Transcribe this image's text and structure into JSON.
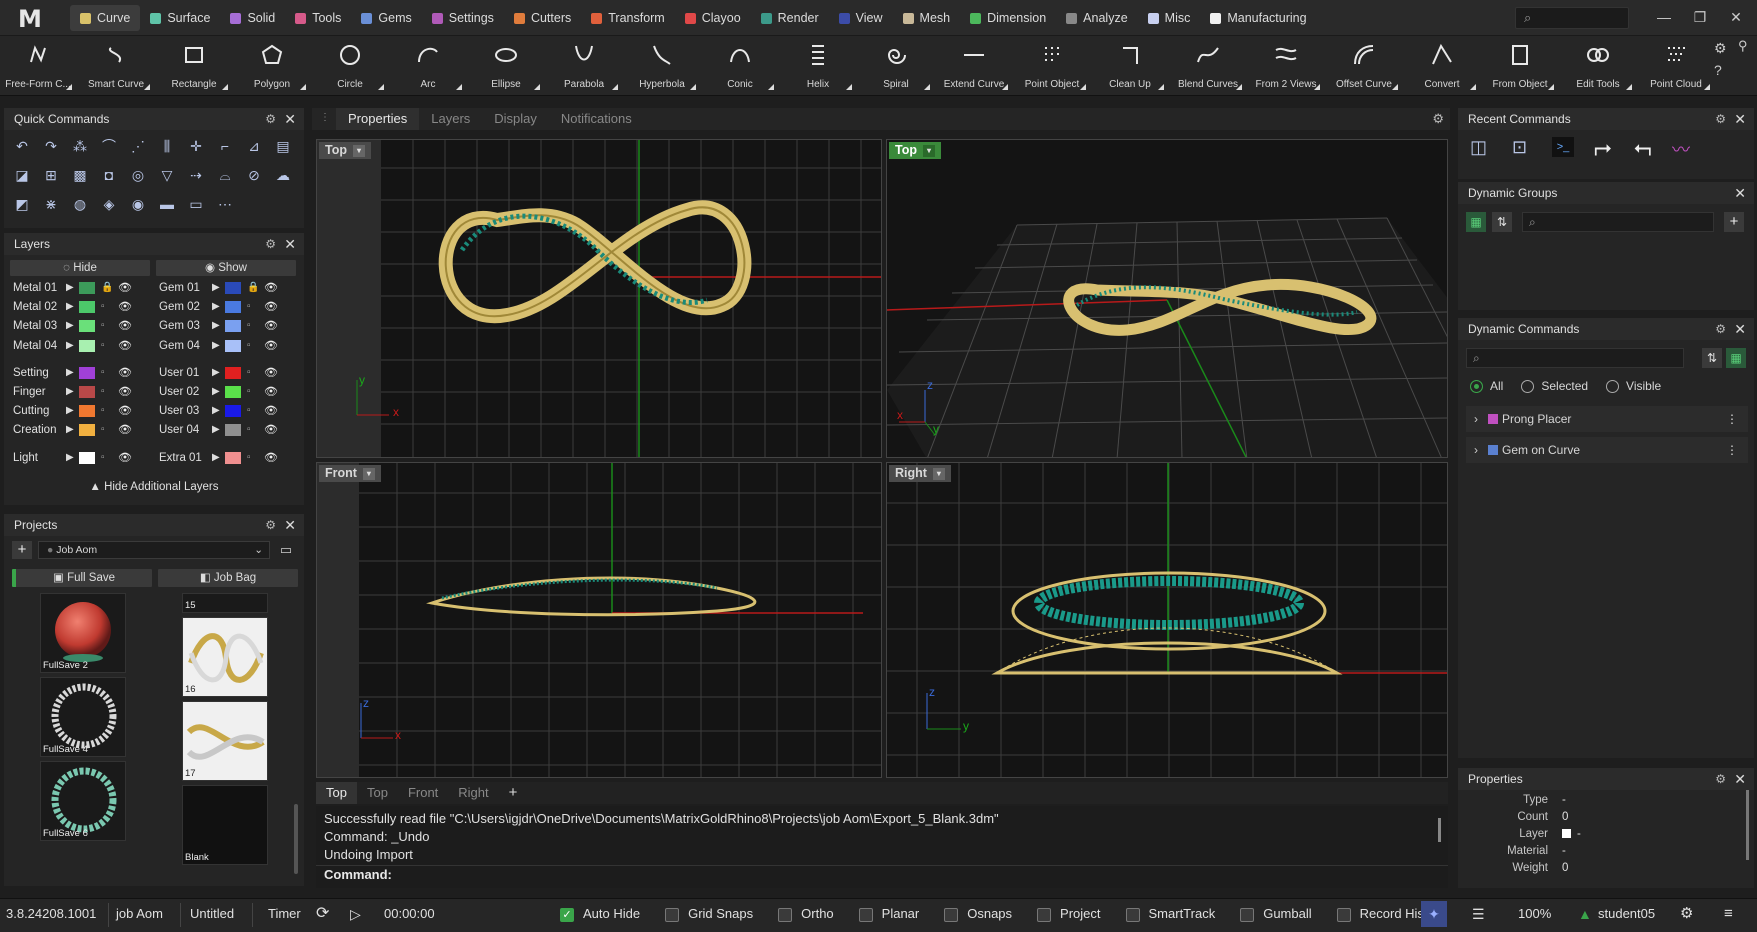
{
  "app": {
    "logo": "M"
  },
  "tabs": [
    {
      "label": "Curve",
      "color": "#d9c26a"
    },
    {
      "label": "Surface",
      "color": "#5fc4a8"
    },
    {
      "label": "Solid",
      "color": "#a66ed6"
    },
    {
      "label": "Tools",
      "color": "#d65a8a"
    },
    {
      "label": "Gems",
      "color": "#6a8fd6"
    },
    {
      "label": "Settings",
      "color": "#b05ab8"
    },
    {
      "label": "Cutters",
      "color": "#e07c3c"
    },
    {
      "label": "Transform",
      "color": "#e0603c"
    },
    {
      "label": "Clayoo",
      "color": "#e04848"
    },
    {
      "label": "Render",
      "color": "#3c9a8a"
    },
    {
      "label": "View",
      "color": "#3c4ca8"
    },
    {
      "label": "Mesh",
      "color": "#c8b898"
    },
    {
      "label": "Dimension",
      "color": "#4cb85c"
    },
    {
      "label": "Analyze",
      "color": "#888888"
    },
    {
      "label": "Misc",
      "color": "#c8d0f0"
    },
    {
      "label": "Manufacturing",
      "color": "#f0f0f0"
    }
  ],
  "search": {
    "icon": "search-icon"
  },
  "tools": [
    "Free-Form C...",
    "Smart Curve",
    "Rectangle",
    "Polygon",
    "Circle",
    "Arc",
    "Ellipse",
    "Parabola",
    "Hyperbola",
    "Conic",
    "Helix",
    "Spiral",
    "Extend Curve",
    "Point Object",
    "Clean Up",
    "Blend Curves",
    "From 2 Views",
    "Offset Curve",
    "Convert",
    "From Object",
    "Edit Tools",
    "Point Cloud"
  ],
  "quick_commands": {
    "title": "Quick Commands"
  },
  "layers": {
    "title": "Layers",
    "hide_label": "Hide",
    "show_label": "Show",
    "left": [
      {
        "name": "Metal 01",
        "color": "#3c9a5a"
      },
      {
        "name": "Metal 02",
        "color": "#4cc86a"
      },
      {
        "name": "Metal 03",
        "color": "#6ae07a"
      },
      {
        "name": "Metal 04",
        "color": "#a8f0b0"
      },
      {
        "name": "Setting",
        "color": "#a040d8"
      },
      {
        "name": "Finger",
        "color": "#b84848"
      },
      {
        "name": "Cutting",
        "color": "#f07830"
      },
      {
        "name": "Creation",
        "color": "#f0b040"
      },
      {
        "name": "Light",
        "color": "#ffffff"
      }
    ],
    "right": [
      {
        "name": "Gem 01",
        "color": "#2a4ab8"
      },
      {
        "name": "Gem 02",
        "color": "#4a7ae0"
      },
      {
        "name": "Gem 03",
        "color": "#7aa0f0"
      },
      {
        "name": "Gem 04",
        "color": "#a8c0f8"
      },
      {
        "name": "User 01",
        "color": "#e02020"
      },
      {
        "name": "User 02",
        "color": "#5ae04a"
      },
      {
        "name": "User 03",
        "color": "#1a1ae8"
      },
      {
        "name": "User 04",
        "color": "#909090"
      },
      {
        "name": "Extra 01",
        "color": "#f09090"
      }
    ],
    "hide_additional": "Hide Additional Layers"
  },
  "projects": {
    "title": "Projects",
    "job": "Job Aom",
    "full_save": "Full Save",
    "job_bag": "Job Bag",
    "thumbs_left": [
      "FullSave 2",
      "FullSave 4",
      "FullSave 6"
    ],
    "thumbs_right": [
      "15",
      "16",
      "17",
      "Blank"
    ]
  },
  "panel_tabs": [
    "Properties",
    "Layers",
    "Display",
    "Notifications"
  ],
  "viewports": {
    "top_left": "Top",
    "top_right": "Top",
    "bottom_left": "Front",
    "bottom_right": "Right"
  },
  "axis": {
    "x": "x",
    "y": "y",
    "z": "z"
  },
  "view_tabs": [
    "Top",
    "Top",
    "Front",
    "Right"
  ],
  "command_log": [
    "Successfully read file \"C:\\Users\\igjdr\\OneDrive\\Documents\\MatrixGoldRhino8\\Projects\\job Aom\\Export_5_Blank.3dm\"",
    "Command: _Undo",
    "Undoing Import"
  ],
  "command_prompt": "Command:",
  "recent_commands": {
    "title": "Recent Commands"
  },
  "dynamic_groups": {
    "title": "Dynamic Groups"
  },
  "dynamic_commands": {
    "title": "Dynamic Commands",
    "filters": [
      "All",
      "Selected",
      "Visible"
    ],
    "items": [
      {
        "label": "Prong Placer",
        "color": "#c050c0"
      },
      {
        "label": "Gem on Curve",
        "color": "#5a80d0"
      }
    ]
  },
  "properties": {
    "title": "Properties",
    "rows": [
      {
        "key": "Type",
        "value": "-"
      },
      {
        "key": "Count",
        "value": "0"
      },
      {
        "key": "Layer",
        "value": "-"
      },
      {
        "key": "Material",
        "value": "-"
      },
      {
        "key": "Weight",
        "value": "0"
      }
    ]
  },
  "status": {
    "version": "3.8.24208.1001",
    "job": "job Aom",
    "file": "Untitled",
    "timer_label": "Timer",
    "timer_value": "00:00:00",
    "toggles": [
      {
        "label": "Auto Hide",
        "on": true
      },
      {
        "label": "Grid Snaps",
        "on": false
      },
      {
        "label": "Ortho",
        "on": false
      },
      {
        "label": "Planar",
        "on": false
      },
      {
        "label": "Osnaps",
        "on": false
      },
      {
        "label": "Project",
        "on": false
      },
      {
        "label": "SmartTrack",
        "on": false
      },
      {
        "label": "Gumball",
        "on": false
      },
      {
        "label": "Record History",
        "on": false
      }
    ],
    "zoom": "100%",
    "user": "student05"
  }
}
